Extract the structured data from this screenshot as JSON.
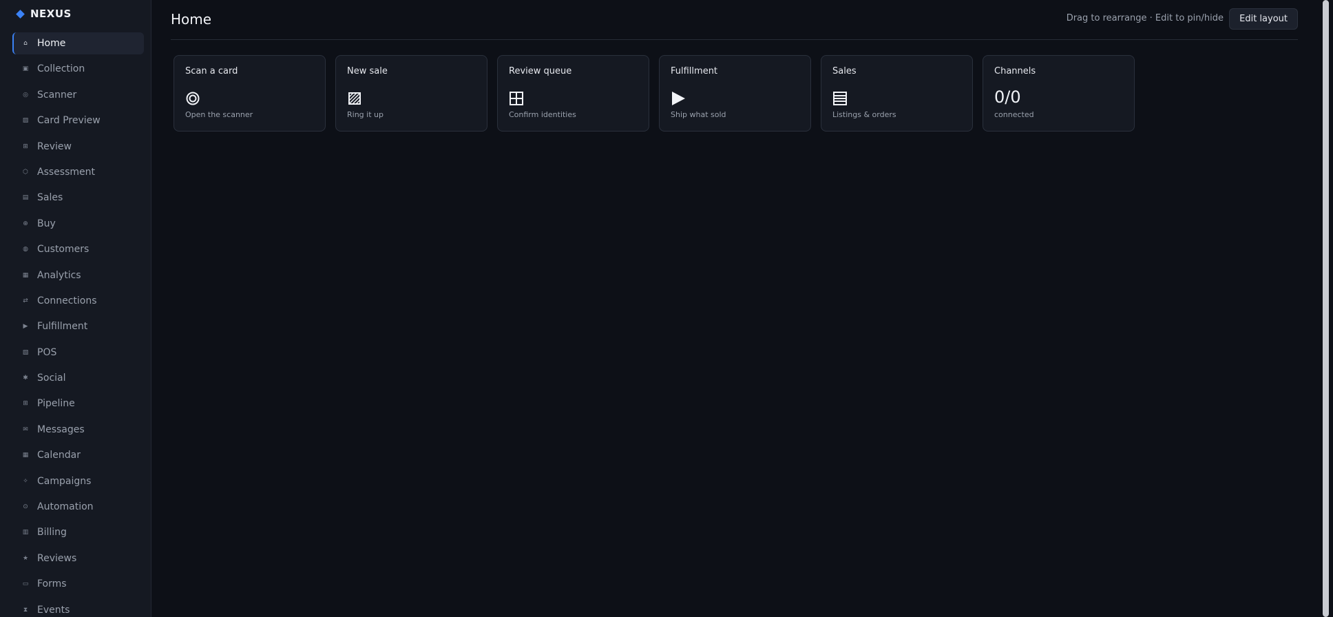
{
  "brand": {
    "name": "NEXUS"
  },
  "sidebar": {
    "items": [
      {
        "label": "Home",
        "icon": "home-icon",
        "glyph": "⌂"
      },
      {
        "label": "Collection",
        "icon": "collection-icon",
        "glyph": "▣"
      },
      {
        "label": "Scanner",
        "icon": "scanner-icon",
        "glyph": "◎"
      },
      {
        "label": "Card Preview",
        "icon": "card-preview-icon",
        "glyph": "▨"
      },
      {
        "label": "Review",
        "icon": "review-icon",
        "glyph": "⊞"
      },
      {
        "label": "Assessment",
        "icon": "assessment-icon",
        "glyph": "⬡"
      },
      {
        "label": "Sales",
        "icon": "sales-icon",
        "glyph": "▤"
      },
      {
        "label": "Buy",
        "icon": "buy-icon",
        "glyph": "⊕"
      },
      {
        "label": "Customers",
        "icon": "customers-icon",
        "glyph": "◍"
      },
      {
        "label": "Analytics",
        "icon": "analytics-icon",
        "glyph": "▦"
      },
      {
        "label": "Connections",
        "icon": "connections-icon",
        "glyph": "⇄"
      },
      {
        "label": "Fulfillment",
        "icon": "fulfillment-icon",
        "glyph": "▶"
      },
      {
        "label": "POS",
        "icon": "pos-icon",
        "glyph": "▧"
      },
      {
        "label": "Social",
        "icon": "social-icon",
        "glyph": "✱"
      },
      {
        "label": "Pipeline",
        "icon": "pipeline-icon",
        "glyph": "⊞"
      },
      {
        "label": "Messages",
        "icon": "messages-icon",
        "glyph": "✉"
      },
      {
        "label": "Calendar",
        "icon": "calendar-icon",
        "glyph": "▦"
      },
      {
        "label": "Campaigns",
        "icon": "campaigns-icon",
        "glyph": "✧"
      },
      {
        "label": "Automation",
        "icon": "automation-icon",
        "glyph": "⊙"
      },
      {
        "label": "Billing",
        "icon": "billing-icon",
        "glyph": "▥"
      },
      {
        "label": "Reviews",
        "icon": "reviews-icon",
        "glyph": "★"
      },
      {
        "label": "Forms",
        "icon": "forms-icon",
        "glyph": "▭"
      },
      {
        "label": "Events",
        "icon": "events-icon",
        "glyph": "⧗"
      }
    ]
  },
  "header": {
    "title": "Home",
    "hint": "Drag to rearrange · Edit to pin/hide",
    "edit_label": "Edit layout"
  },
  "tiles": [
    {
      "title": "Scan a card",
      "icon": "target-icon",
      "subtitle": "Open the scanner"
    },
    {
      "title": "New sale",
      "icon": "sale-icon",
      "subtitle": "Ring it up"
    },
    {
      "title": "Review queue",
      "icon": "grid-icon",
      "subtitle": "Confirm identities"
    },
    {
      "title": "Fulfillment",
      "icon": "play-icon",
      "subtitle": "Ship what sold"
    },
    {
      "title": "Sales",
      "icon": "list-icon",
      "subtitle": "Listings & orders"
    },
    {
      "title": "Channels",
      "value": "0/0",
      "subtitle": "connected"
    }
  ],
  "colors": {
    "accent": "#3b82f6",
    "background": "#0d1017",
    "sidebar": "#151922"
  }
}
